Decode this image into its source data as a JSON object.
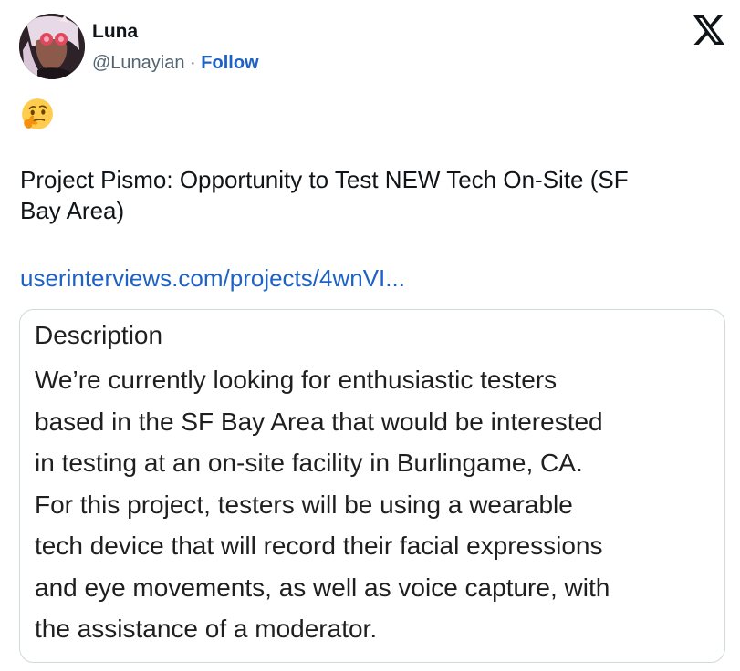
{
  "author": {
    "name": "Luna",
    "handle": "@Lunayian",
    "separator": " · ",
    "follow_label": "Follow"
  },
  "platform_logo": "x-logo-icon",
  "tweet": {
    "emoji": "🤔",
    "emoji_icon": "thinking-face-icon",
    "title_lines": [
      "Project Pismo: Opportunity to Test NEW Tech On-Site (SF",
      "Bay Area)"
    ],
    "link": "userinterviews.com/projects/4wnVI..."
  },
  "card": {
    "title": "Description",
    "body_lines": [
      "We’re currently looking for enthusiastic testers",
      "based in the SF Bay Area that would be interested",
      "in testing at an on-site facility in Burlingame, CA.",
      "For this project, testers will be using a wearable",
      "tech device that will record their facial expressions",
      "and eye movements, as well as voice capture, with",
      "the assistance of a moderator."
    ]
  },
  "colors": {
    "link": "#1d62c4",
    "secondary_text": "#536471",
    "border": "#cfd9de"
  }
}
